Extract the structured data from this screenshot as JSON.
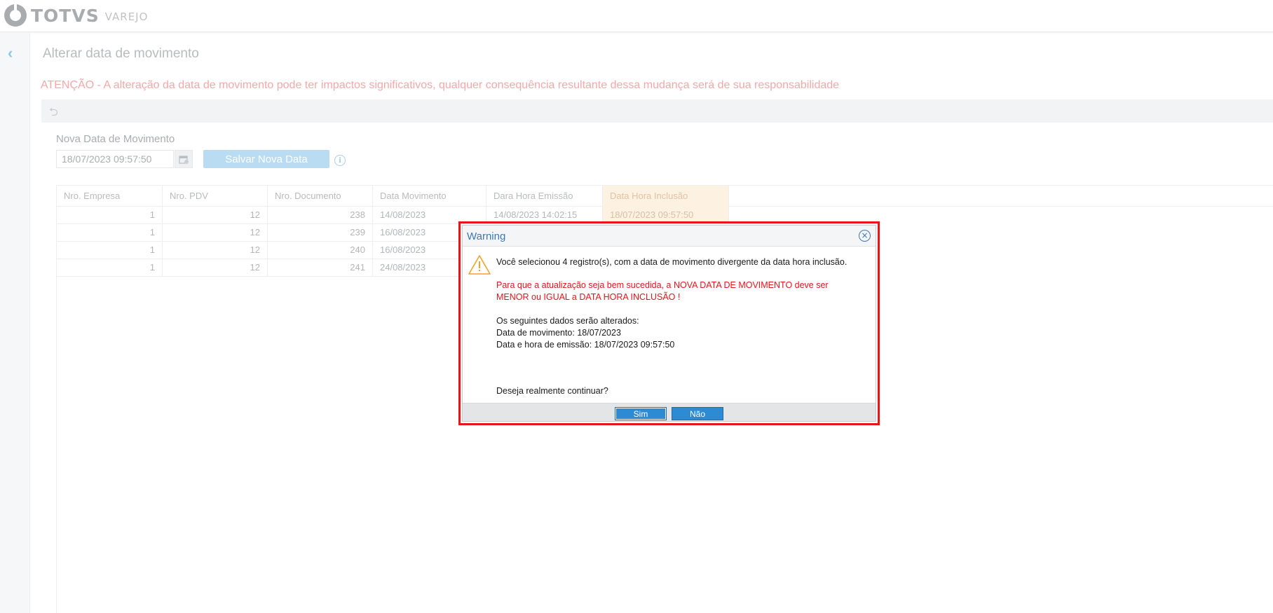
{
  "app": {
    "brand": "TOTVS",
    "brand_sub": "VAREJO"
  },
  "page": {
    "title": "Alterar data de movimento",
    "warning": "ATENÇÃO - A alteração da data de movimento pode ter impactos significativos, qualquer consequência resultante dessa mudança será de sua responsabilidade"
  },
  "form": {
    "label": "Nova Data de Movimento",
    "date_value": "18/07/2023 09:57:50",
    "save_label": "Salvar Nova Data"
  },
  "grid": {
    "columns": [
      "Nro. Empresa",
      "Nro. PDV",
      "Nro. Documento",
      "Data Movimento",
      "Dara Hora Emissão",
      "Data Hora Inclusão"
    ],
    "rows": [
      [
        "1",
        "12",
        "238",
        "14/08/2023",
        "14/08/2023 14:02:15",
        "18/07/2023 09:57:50"
      ],
      [
        "1",
        "12",
        "239",
        "16/08/2023",
        "",
        ""
      ],
      [
        "1",
        "12",
        "240",
        "16/08/2023",
        "",
        ""
      ],
      [
        "1",
        "12",
        "241",
        "24/08/2023",
        "",
        ""
      ]
    ]
  },
  "modal": {
    "title": "Warning",
    "line1": "Você selecionou 4 registro(s), com a data de movimento divergente da data hora inclusão.",
    "red_line1": "Para que a atualização seja bem sucedida, a NOVA DATA DE MOVIMENTO deve ser",
    "red_line2": "MENOR ou IGUAL a DATA HORA INCLUSÃO !",
    "changes_intro": "Os seguintes dados serão alterados:",
    "change1": "Data de movimento: 18/07/2023",
    "change2": "Data e hora de emissão: 18/07/2023 09:57:50",
    "question": "Deseja realmente continuar?",
    "yes_label": "Sim",
    "no_label": "Não"
  },
  "colors": {
    "accent": "#2f8ad4",
    "highlight_border": "#e8141b",
    "warning_text": "#f4a8a8"
  }
}
